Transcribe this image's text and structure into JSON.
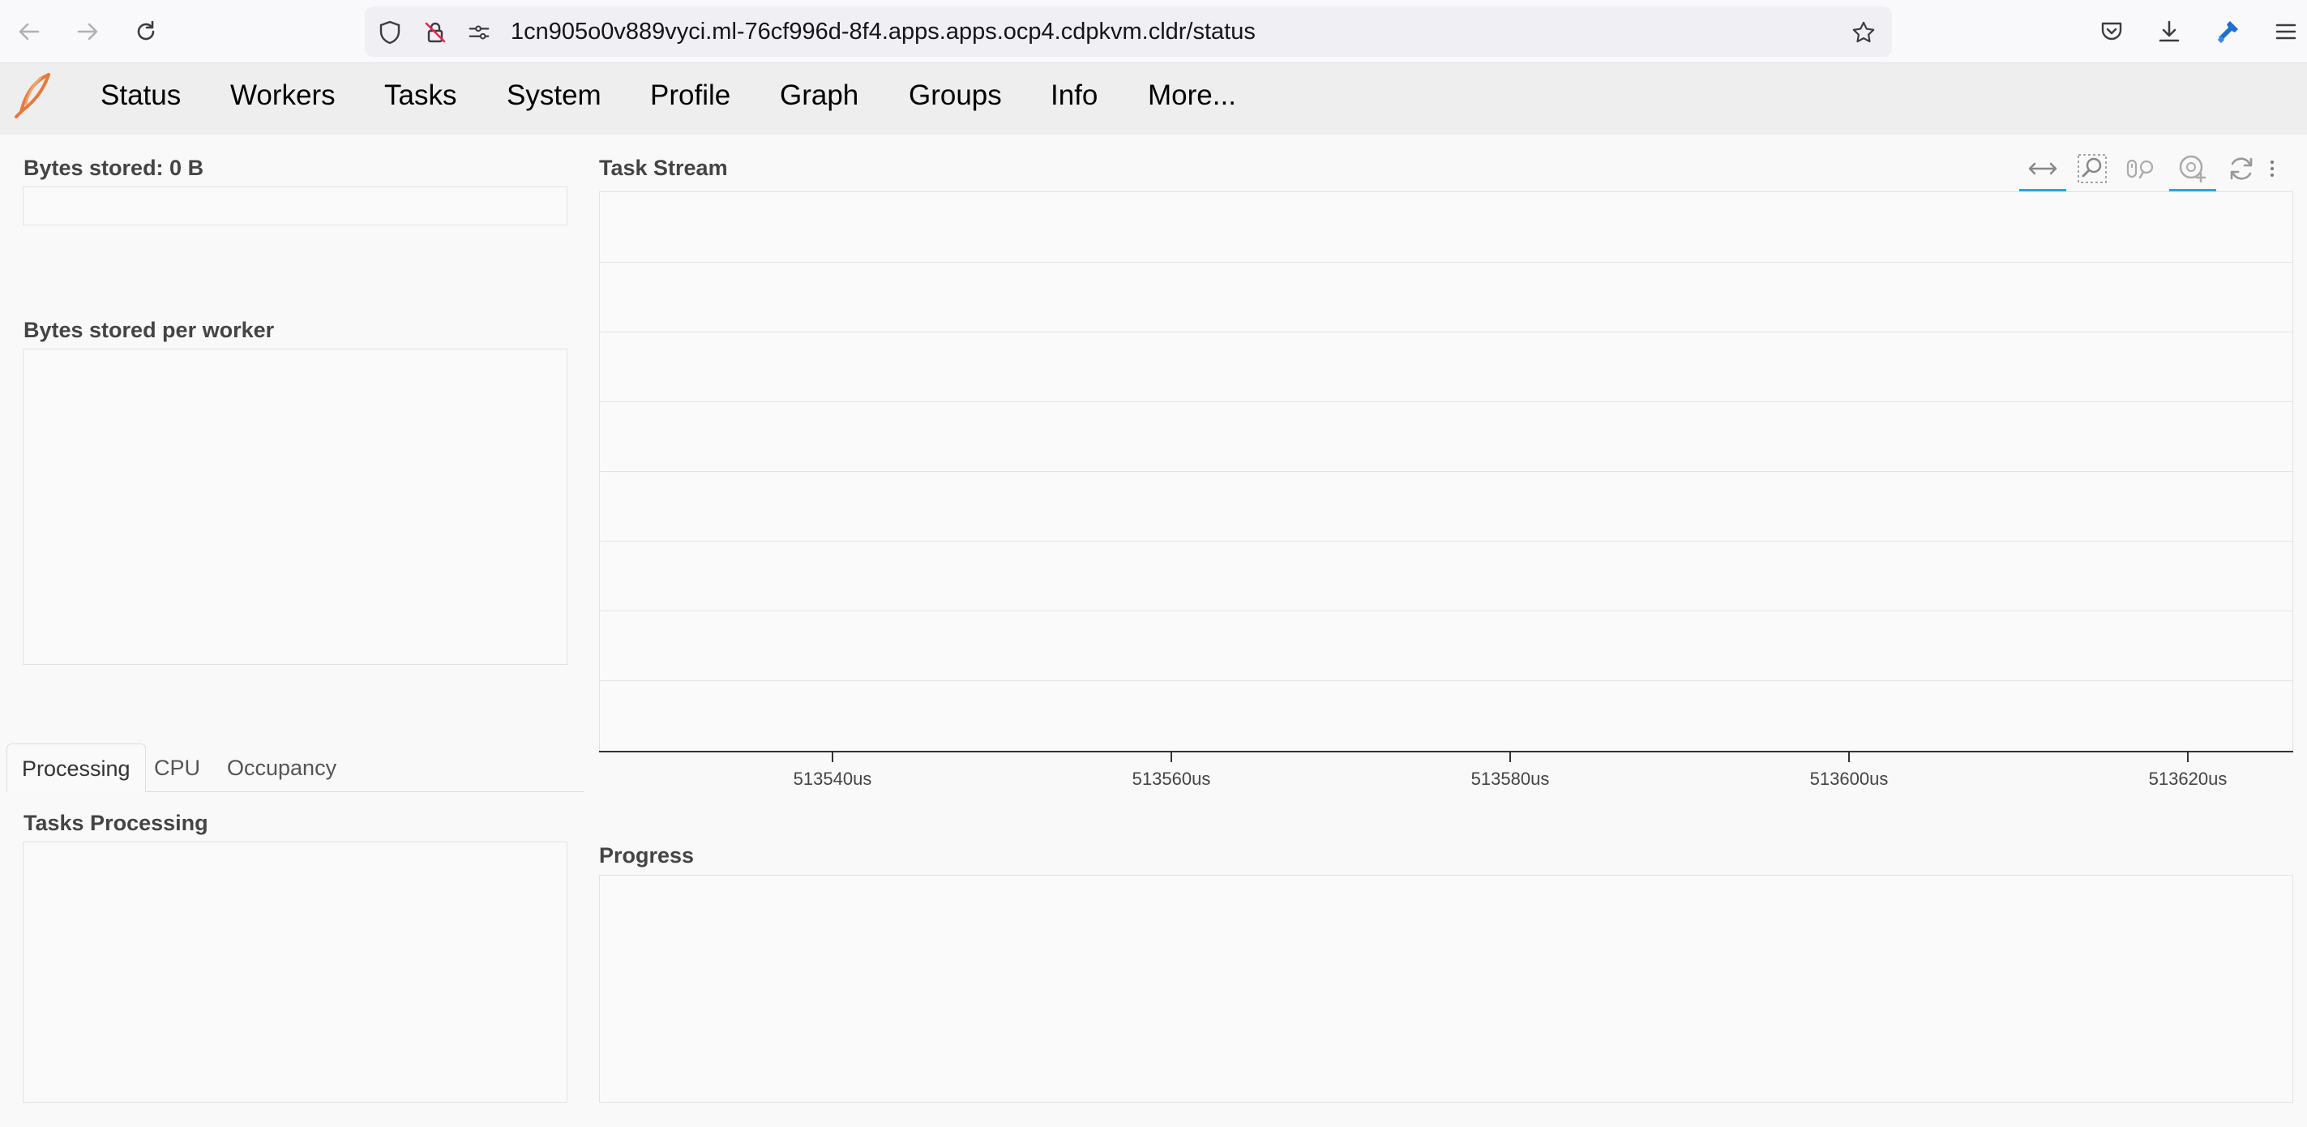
{
  "browser": {
    "url": "1cn905o0v889vyci.ml-76cf996d-8f4.apps.apps.ocp4.cdpkvm.cldr/status"
  },
  "nav": {
    "items": [
      "Status",
      "Workers",
      "Tasks",
      "System",
      "Profile",
      "Graph",
      "Groups",
      "Info",
      "More..."
    ]
  },
  "left": {
    "bytes_stored_title": "Bytes stored: 0 B",
    "bytes_per_worker_title": "Bytes stored per worker",
    "tabs": [
      "Processing",
      "CPU",
      "Occupancy"
    ],
    "active_tab": "Processing",
    "tasks_processing_title": "Tasks Processing"
  },
  "task_stream": {
    "title": "Task Stream",
    "tools": [
      "pan-icon",
      "box-zoom-icon",
      "wheel-zoom-icon",
      "hover-icon",
      "reset-icon",
      "more-icon"
    ],
    "tick_labels": [
      "513540us",
      "513560us",
      "513580us",
      "513600us",
      "513620us"
    ]
  },
  "progress": {
    "title": "Progress"
  },
  "colors": {
    "tool_active": "#26aae1",
    "logo": "#e37a3f"
  }
}
